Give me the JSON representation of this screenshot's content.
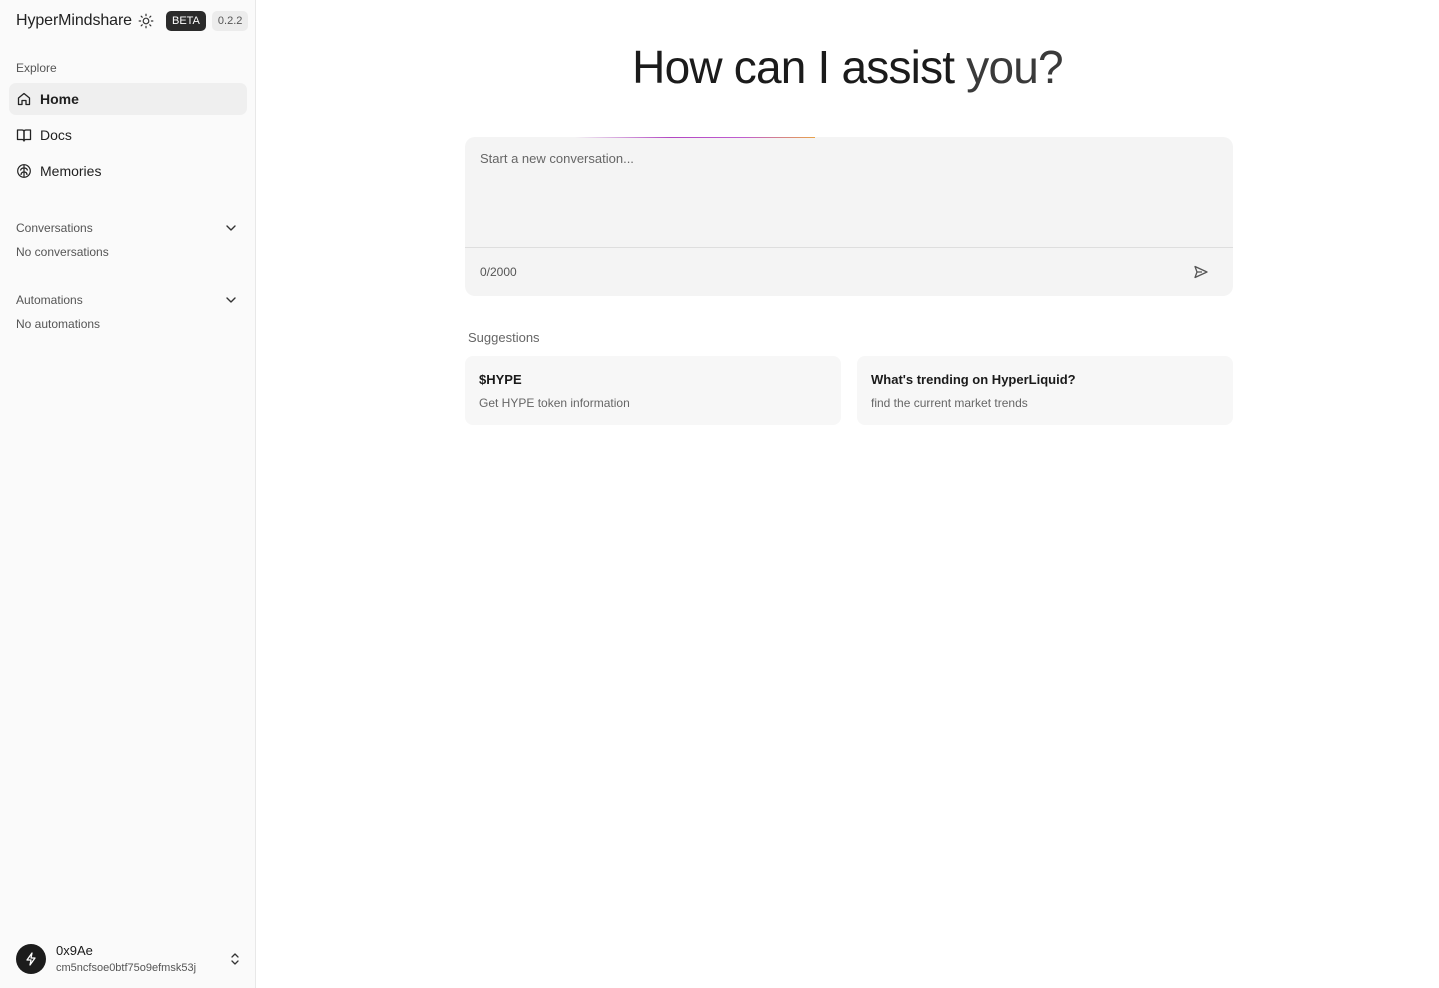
{
  "sidebar": {
    "brand": "HyperMindshare",
    "beta_label": "BETA",
    "version": "0.2.2",
    "explore_label": "Explore",
    "nav": [
      {
        "label": "Home",
        "icon": "home-icon",
        "active": true
      },
      {
        "label": "Docs",
        "icon": "book-icon",
        "active": false
      },
      {
        "label": "Memories",
        "icon": "brain-icon",
        "active": false
      }
    ],
    "conversations": {
      "label": "Conversations",
      "empty": "No conversations"
    },
    "automations": {
      "label": "Automations",
      "empty": "No automations"
    },
    "user": {
      "name": "0x9Ae",
      "id": "cm5ncfsoe0btf75o9efmsk53j"
    }
  },
  "main": {
    "headline_main": "How can I assist",
    "headline_end": "you?",
    "composer": {
      "placeholder": "Start a new conversation...",
      "count": "0/2000"
    },
    "suggestions_label": "Suggestions",
    "suggestions": [
      {
        "title": "$HYPE",
        "subtitle": "Get HYPE token information"
      },
      {
        "title": "What's trending on HyperLiquid?",
        "subtitle": "find the current market trends"
      }
    ]
  },
  "colors": {
    "accent_dark": "#1c1c1c",
    "sidebar_bg": "#fafafa",
    "glow_purple": "#b246c2",
    "glow_orange": "#e8a24a"
  }
}
